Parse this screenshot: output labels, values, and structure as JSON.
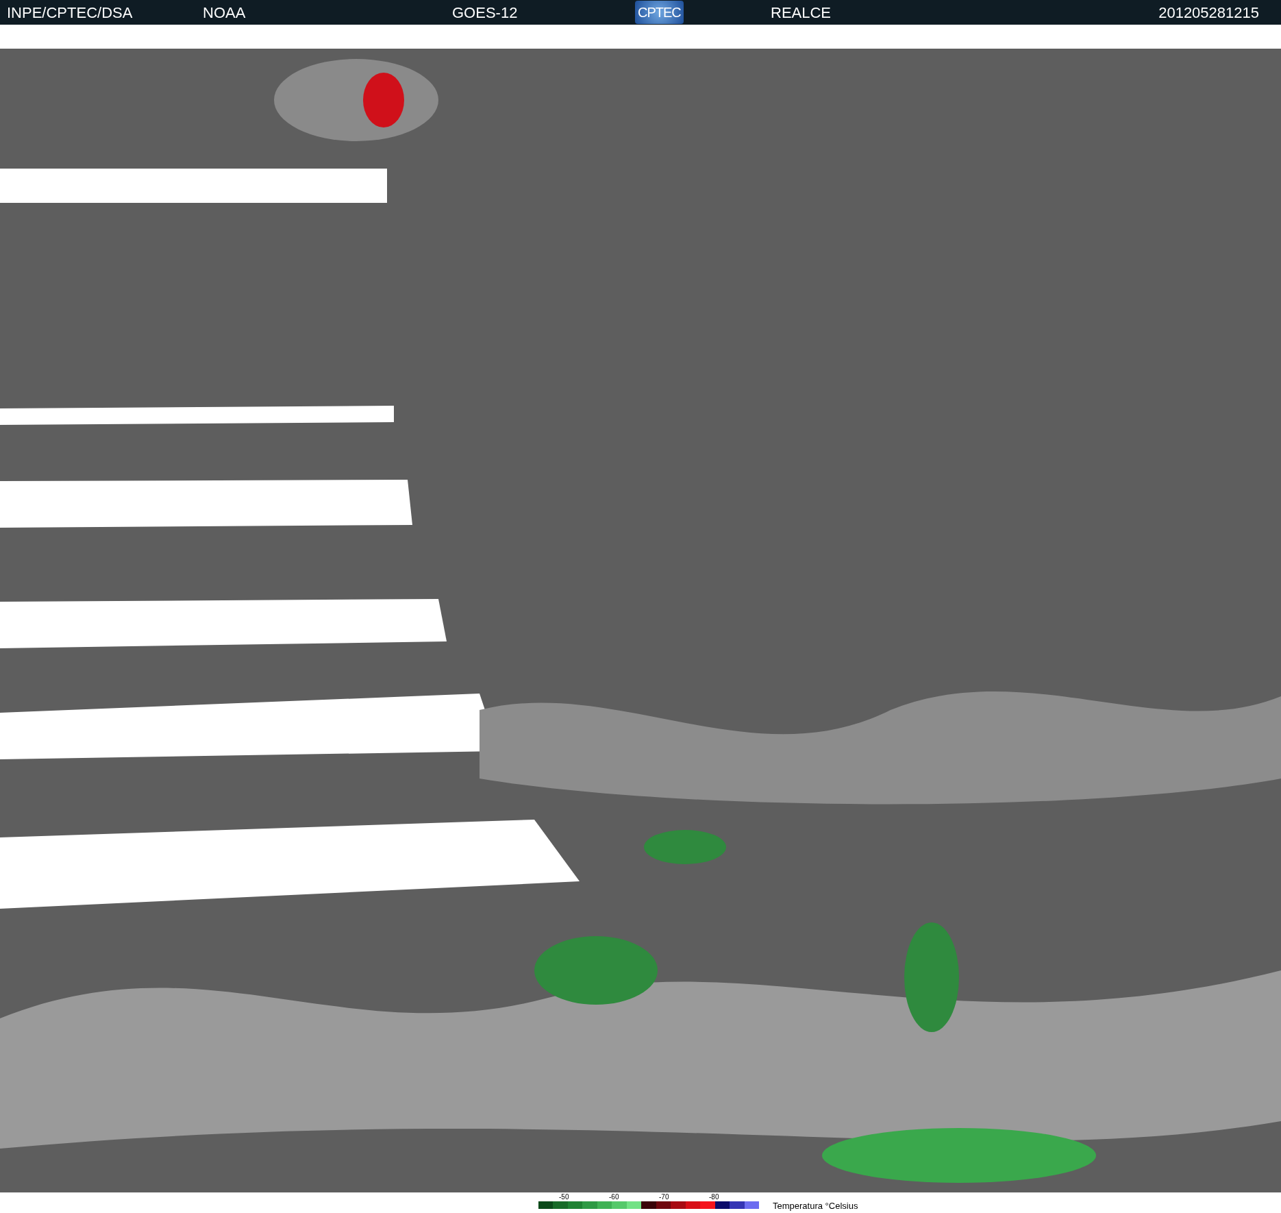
{
  "header": {
    "items": [
      {
        "kind": "text",
        "text": "INPE/CPTEC/DSA"
      },
      {
        "kind": "text",
        "text": "NOAA"
      },
      {
        "kind": "text",
        "text": "GOES-12"
      },
      {
        "kind": "logo",
        "text": "CPTEC"
      },
      {
        "kind": "text",
        "text": "REALCE"
      },
      {
        "kind": "text",
        "text": "201205281215"
      }
    ]
  },
  "legend": {
    "ticks": [
      "-50",
      "-60",
      "-70",
      "-80"
    ],
    "title": "Temperatura °Celsius",
    "swatches": [
      {
        "color": "#0b4a1a"
      },
      {
        "color": "#176b28"
      },
      {
        "color": "#1f8233"
      },
      {
        "color": "#2e9a44"
      },
      {
        "color": "#40b255"
      },
      {
        "color": "#55c96a"
      },
      {
        "color": "#72e285"
      },
      {
        "color": "#3a0408"
      },
      {
        "color": "#70070e"
      },
      {
        "color": "#a80b12"
      },
      {
        "color": "#d80e16"
      },
      {
        "color": "#f5141c"
      },
      {
        "color": "#0a0a6a"
      },
      {
        "color": "#3434b4"
      },
      {
        "color": "#6c6cf0"
      }
    ]
  }
}
